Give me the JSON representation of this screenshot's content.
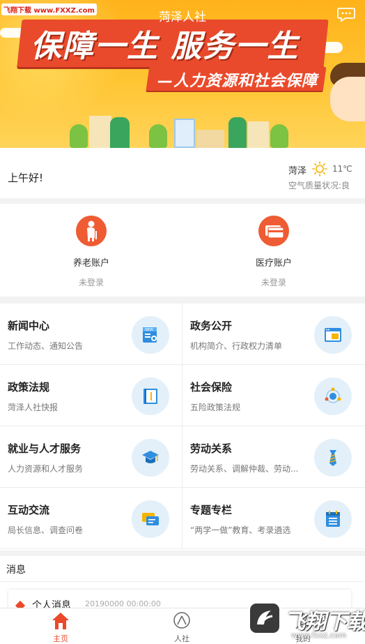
{
  "watermark_top": "飞翔下载 www.FXXZ.com",
  "header": {
    "title": "菏泽人社",
    "banner_slogan": "保障一生 服务一生",
    "banner_subtitle": "—人力资源和社会保障"
  },
  "greeting": {
    "hello": "上午好!",
    "city": "菏泽",
    "temperature": "11℃",
    "air_quality": "空气质量状况:良"
  },
  "accounts": [
    {
      "name": "养老账户",
      "state": "未登录"
    },
    {
      "name": "医疗账户",
      "state": "未登录"
    }
  ],
  "services": [
    {
      "title": "新闻中心",
      "subtitle": "工作动态、通知公告",
      "icon": "news-icon"
    },
    {
      "title": "政务公开",
      "subtitle": "机构简介、行政权力清单",
      "icon": "browser-icon"
    },
    {
      "title": "政策法规",
      "subtitle": "菏泽人社快报",
      "icon": "book-icon"
    },
    {
      "title": "社会保险",
      "subtitle": "五险政策法规",
      "icon": "network-icon"
    },
    {
      "title": "就业与人才服务",
      "subtitle": "人力资源和人才服务",
      "icon": "graduation-cap-icon"
    },
    {
      "title": "劳动关系",
      "subtitle": "劳动关系、调解仲裁、劳动...",
      "icon": "tie-icon"
    },
    {
      "title": "互动交流",
      "subtitle": "局长信息、调查问卷",
      "icon": "chat-bubbles-icon"
    },
    {
      "title": "专题专栏",
      "subtitle": "“两学一做”教育、考录遴选",
      "icon": "calendar-list-icon"
    }
  ],
  "messages": {
    "header": "消息",
    "items": [
      {
        "title": "个人消息",
        "time": "20190000 00:00:00"
      }
    ]
  },
  "tabbar": [
    {
      "label": "主页",
      "active": true
    },
    {
      "label": "人社",
      "active": false
    },
    {
      "label": "我的",
      "active": false
    }
  ],
  "watermark_bottom": {
    "brand": "飞翔下载",
    "url": "www.fxxz.com"
  },
  "colors": {
    "accent": "#e94a2c",
    "banner": "#ffc533",
    "icon_bg": "#e3f0fa"
  }
}
